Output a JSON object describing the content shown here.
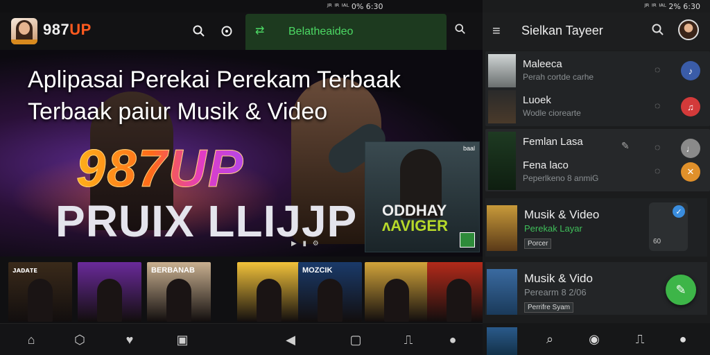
{
  "status_left": {
    "text": "ᴶᴿ ᴵᴿ ᴵᴬᴸ 0% 6:30"
  },
  "status_right": {
    "text": "ᴶᴿ ᴵᴿ ᴵᴬᴸ 2% 6:30"
  },
  "left": {
    "brand_prefix": "987",
    "brand_suffix": "UP",
    "search": {
      "value": "Belatheaideo"
    },
    "hero": {
      "title_line1": "Aplipasai Perekai Perekam Terbaak",
      "title_line2": "Terbaak  paiur Musik & Video",
      "brand": "987UP",
      "subtitle": "PRUIX LLIJJP",
      "card_line1": "ODDHAY",
      "card_line2": "ᴧAVIGER",
      "card_badge": "baal"
    },
    "thumbnails": [
      {
        "caption": "ᴊᴀᴅᴀᴛᴇ",
        "color": "#3a2a1a"
      },
      {
        "caption": "",
        "color": "#6a2a9a"
      },
      {
        "caption": "BERBANAB",
        "color": "#c9b090"
      },
      {
        "caption": "",
        "color": "#f2c23a"
      },
      {
        "caption": "MOZCIK",
        "color": "#1a3a6a"
      },
      {
        "caption": "",
        "color": "#d2a43a"
      },
      {
        "caption": "",
        "color": "#b32a1a"
      }
    ]
  },
  "right": {
    "title": "Sielkan Tayeer",
    "rows": [
      {
        "title": "Maleeca",
        "sub": "Perah cortde carhe",
        "circle_color": "#3a5ca8",
        "circle_icon": "mic-icon"
      },
      {
        "title": "Luoek",
        "sub": "Wodle ciorearte",
        "circle_color": "#d33a3a",
        "circle_icon": "music-icon"
      },
      {
        "title": "Femlan Lasa",
        "sub": "",
        "circle_color": "#8a8a8a",
        "circle_icon": "note-icon"
      },
      {
        "title": "Fena laco",
        "sub": "Peperlkeno 8 anmiG",
        "circle_color": "#e0902a",
        "circle_icon": "tools-icon"
      }
    ],
    "card1": {
      "title": "Musik & Video",
      "sub": "Perekak Layar",
      "chip": "Porcer",
      "side_label": "60"
    },
    "card2": {
      "title": "Musik & Vido",
      "sub": "Perearm 8 2/06",
      "chip": "Perrifre Syam"
    }
  }
}
